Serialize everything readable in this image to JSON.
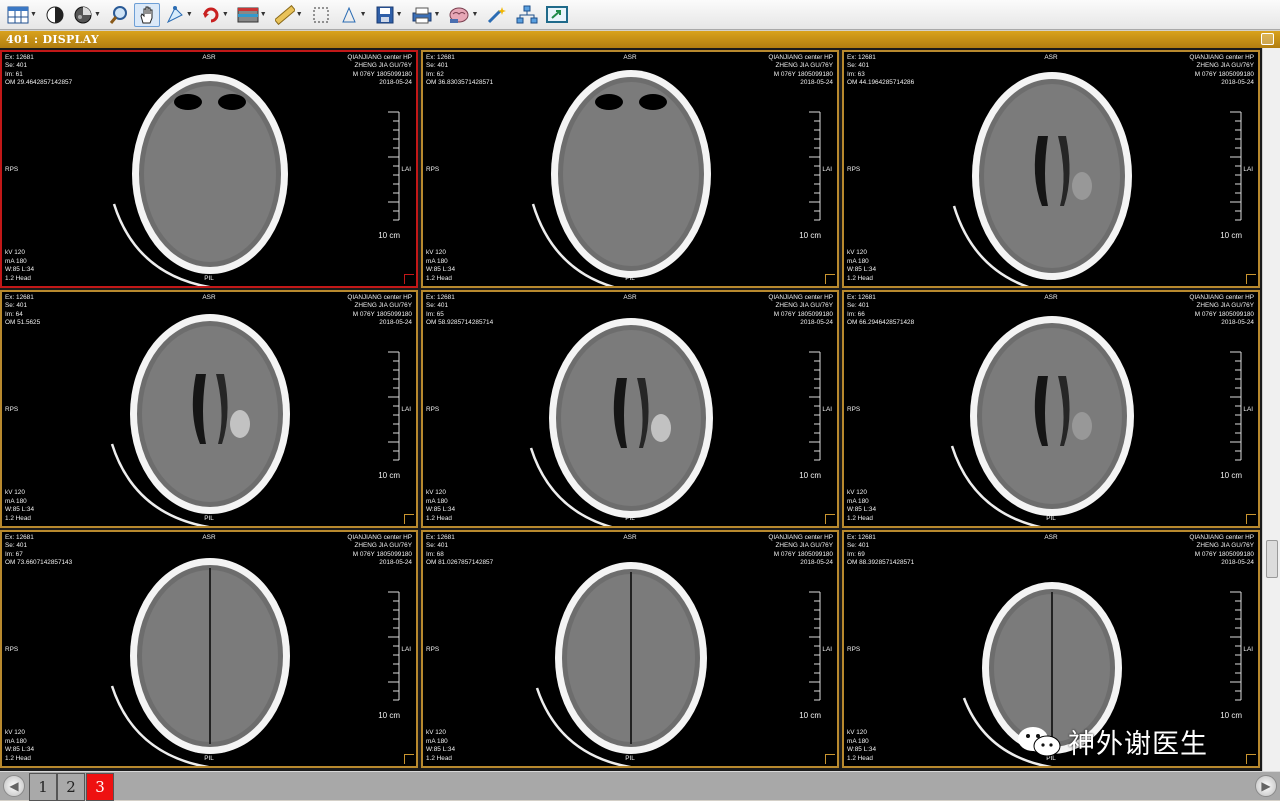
{
  "window": {
    "title": "401 : DISPLAY"
  },
  "toolbar": {
    "icons": [
      "layout-grid-icon",
      "contrast-icon",
      "color-map-icon",
      "zoom-icon",
      "pan-hand-icon",
      "roi-icon",
      "rotate-icon",
      "lut-icon",
      "ruler-icon",
      "select-rect-icon",
      "triangle-measure-icon",
      "save-icon",
      "print-icon",
      "brain-3d-icon",
      "magic-tools-icon",
      "network-icon",
      "export-screen-icon"
    ]
  },
  "cells": [
    {
      "ex": "Ex: 12681",
      "se": "Se: 401",
      "im": "Im: 61",
      "om": "OM 29.4642857142857",
      "hospital": "QIANJIANG center HP",
      "patient": "ZHENG JIA GU/76Y",
      "id": "M 076Y 1805099180",
      "date": "2018-05-24",
      "top": "ASR",
      "bottom": "PIL",
      "left": "RPS",
      "right": "LAI",
      "scale": "10 cm",
      "kv": "kV 120",
      "ma": "mA 180",
      "window": "W:85 L:34",
      "thick": "1.2 Head"
    },
    {
      "ex": "Ex: 12681",
      "se": "Se: 401",
      "im": "Im: 62",
      "om": "OM 36.8303571428571",
      "hospital": "QIANJIANG center HP",
      "patient": "ZHENG JIA GU/76Y",
      "id": "M 076Y 1805099180",
      "date": "2018-05-24",
      "top": "ASR",
      "bottom": "PIL",
      "left": "RPS",
      "right": "LAI",
      "scale": "10 cm",
      "kv": "kV 120",
      "ma": "mA 180",
      "window": "W:85 L:34",
      "thick": "1.2 Head"
    },
    {
      "ex": "Ex: 12681",
      "se": "Se: 401",
      "im": "Im: 63",
      "om": "OM 44.1964285714286",
      "hospital": "QIANJIANG center HP",
      "patient": "ZHENG JIA GU/76Y",
      "id": "M 076Y 1805099180",
      "date": "2018-05-24",
      "top": "ASR",
      "bottom": "PIL",
      "left": "RPS",
      "right": "LAI",
      "scale": "10 cm",
      "kv": "kV 120",
      "ma": "mA 180",
      "window": "W:85 L:34",
      "thick": "1.2 Head"
    },
    {
      "ex": "Ex: 12681",
      "se": "Se: 401",
      "im": "Im: 64",
      "om": "OM 51.5625",
      "hospital": "QIANJIANG center HP",
      "patient": "ZHENG JIA GU/76Y",
      "id": "M 076Y 1805099180",
      "date": "2018-05-24",
      "top": "ASR",
      "bottom": "PIL",
      "left": "RPS",
      "right": "LAI",
      "scale": "10 cm",
      "kv": "kV 120",
      "ma": "mA 180",
      "window": "W:85 L:34",
      "thick": "1.2 Head"
    },
    {
      "ex": "Ex: 12681",
      "se": "Se: 401",
      "im": "Im: 65",
      "om": "OM 58.9285714285714",
      "hospital": "QIANJIANG center HP",
      "patient": "ZHENG JIA GU/76Y",
      "id": "M 076Y 1805099180",
      "date": "2018-05-24",
      "top": "ASR",
      "bottom": "PIL",
      "left": "RPS",
      "right": "LAI",
      "scale": "10 cm",
      "kv": "kV 120",
      "ma": "mA 180",
      "window": "W:85 L:34",
      "thick": "1.2 Head"
    },
    {
      "ex": "Ex: 12681",
      "se": "Se: 401",
      "im": "Im: 66",
      "om": "OM 66.2946428571428",
      "hospital": "QIANJIANG center HP",
      "patient": "ZHENG JIA GU/76Y",
      "id": "M 076Y 1805099180",
      "date": "2018-05-24",
      "top": "ASR",
      "bottom": "PIL",
      "left": "RPS",
      "right": "LAI",
      "scale": "10 cm",
      "kv": "kV 120",
      "ma": "mA 180",
      "window": "W:85 L:34",
      "thick": "1.2 Head"
    },
    {
      "ex": "Ex: 12681",
      "se": "Se: 401",
      "im": "Im: 67",
      "om": "OM 73.6607142857143",
      "hospital": "QIANJIANG center HP",
      "patient": "ZHENG JIA GU/76Y",
      "id": "M 076Y 1805099180",
      "date": "2018-05-24",
      "top": "ASR",
      "bottom": "PIL",
      "left": "RPS",
      "right": "LAI",
      "scale": "10 cm",
      "kv": "kV 120",
      "ma": "mA 180",
      "window": "W:85 L:34",
      "thick": "1.2 Head"
    },
    {
      "ex": "Ex: 12681",
      "se": "Se: 401",
      "im": "Im: 68",
      "om": "OM 81.0267857142857",
      "hospital": "QIANJIANG center HP",
      "patient": "ZHENG JIA GU/76Y",
      "id": "M 076Y 1805099180",
      "date": "2018-05-24",
      "top": "ASR",
      "bottom": "PIL",
      "left": "RPS",
      "right": "LAI",
      "scale": "10 cm",
      "kv": "kV 120",
      "ma": "mA 180",
      "window": "W:85 L:34",
      "thick": "1.2 Head"
    },
    {
      "ex": "Ex: 12681",
      "se": "Se: 401",
      "im": "Im: 69",
      "om": "OM 88.3928571428571",
      "hospital": "QIANJIANG center HP",
      "patient": "ZHENG JIA GU/76Y",
      "id": "M 076Y 1805099180",
      "date": "2018-05-24",
      "top": "ASR",
      "bottom": "PIL",
      "left": "RPS",
      "right": "LAI",
      "scale": "10 cm",
      "kv": "kV 120",
      "ma": "mA 180",
      "window": "W:85 L:34",
      "thick": "1.2 Head"
    }
  ],
  "pagination": {
    "pages": [
      "1",
      "2",
      "3"
    ],
    "current": "3"
  },
  "watermark": {
    "text": "神外谢医生"
  },
  "colors": {
    "cell_border": "#b8892e",
    "selected_border": "#c21818",
    "title_bar": "#c8921a",
    "current_page": "#ee1111"
  }
}
